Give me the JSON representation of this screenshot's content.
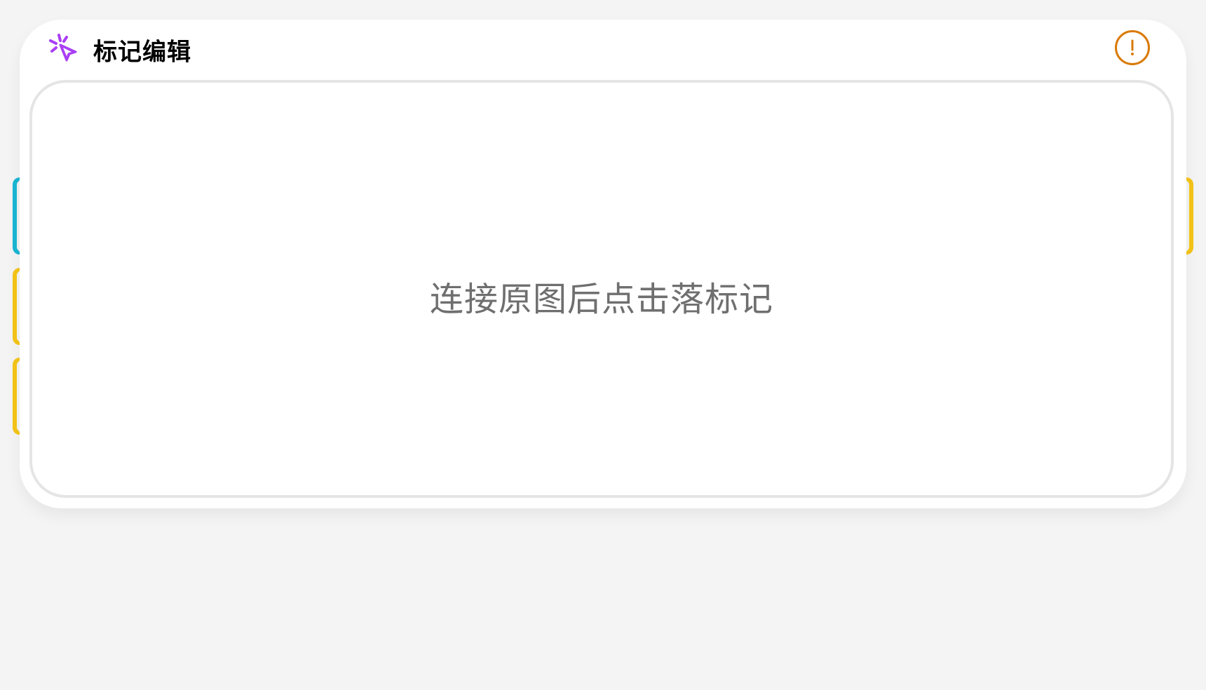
{
  "header": {
    "title": "标记编辑",
    "logo_icon": "cursor-click-icon",
    "alert_icon": "exclamation-circle-icon"
  },
  "canvas": {
    "placeholder": "连接原图后点击落标记"
  },
  "side_tabs": {
    "left": [
      {
        "name": "side-tab-left-1",
        "color": "#1bb7d4"
      },
      {
        "name": "side-tab-left-2",
        "color": "#f5c518"
      },
      {
        "name": "side-tab-left-3",
        "color": "#f5c518"
      }
    ],
    "right": [
      {
        "name": "side-tab-right-1",
        "color": "#f5c518"
      }
    ]
  },
  "colors": {
    "accent_purple": "#a93ef5",
    "alert_orange": "#d97a06",
    "background": "#f4f4f4",
    "panel": "#ffffff",
    "border": "#e5e5e5",
    "placeholder_text": "#6f6f6f"
  }
}
